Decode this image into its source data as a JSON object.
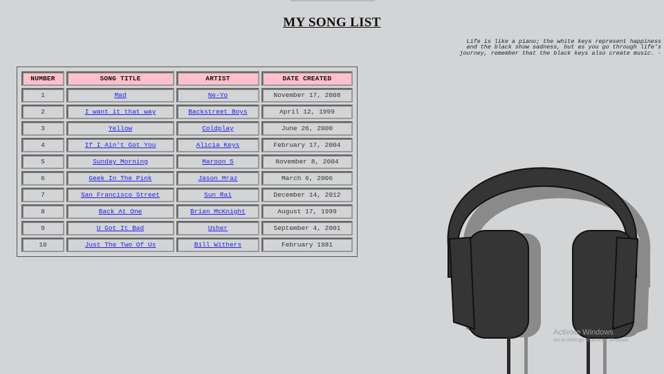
{
  "page": {
    "title": "MY SONG LIST",
    "quote": "Life is like a piano; the white keys represent happiness and the black show sadness, but as you go through life's journey, remember that the black keys also create music. -"
  },
  "table": {
    "headers": {
      "number": "NUMBER",
      "song_title": "SONG TITLE",
      "artist": "ARTIST",
      "date_created": "DATE CREATED"
    },
    "rows": [
      {
        "number": "1",
        "title": "Mad",
        "artist": "Ne-Yo",
        "date": "November 17, 2008"
      },
      {
        "number": "2",
        "title": "I want it that way",
        "artist": "Backstreet Boys",
        "date": "April 12, 1999"
      },
      {
        "number": "3",
        "title": "Yellow",
        "artist": "Coldplay",
        "date": "June 26, 2000"
      },
      {
        "number": "4",
        "title": "If I Ain't Got You",
        "artist": "Alicia Keys",
        "date": "February 17, 2004"
      },
      {
        "number": "5",
        "title": "Sunday Morning",
        "artist": "Maroon 5",
        "date": "November 8, 2004"
      },
      {
        "number": "6",
        "title": "Geek In The Pink",
        "artist": "Jason Mraz",
        "date": "March 6, 2006"
      },
      {
        "number": "7",
        "title": "San Francisco Street",
        "artist": "Sun Rai",
        "date": "December 14, 2012"
      },
      {
        "number": "8",
        "title": "Back At One",
        "artist": "Brian McKnight",
        "date": "August 17, 1999"
      },
      {
        "number": "9",
        "title": "U Got It Bad",
        "artist": "Usher",
        "date": "September 4, 2001"
      },
      {
        "number": "10",
        "title": "Just The Two Of Us",
        "artist": "Bill Withers",
        "date": "February 1981"
      }
    ]
  },
  "watermark": {
    "line1": "Activate Windows",
    "line2": "Go to Settings to activate Windows."
  },
  "icons": {
    "headphones": "headphones-icon"
  },
  "colors": {
    "background": "#d3d4d6",
    "header_bg": "#ffc0cb",
    "link": "#2222ee",
    "headphones": "#353535",
    "headphones_shadow": "#8a8a8a"
  }
}
